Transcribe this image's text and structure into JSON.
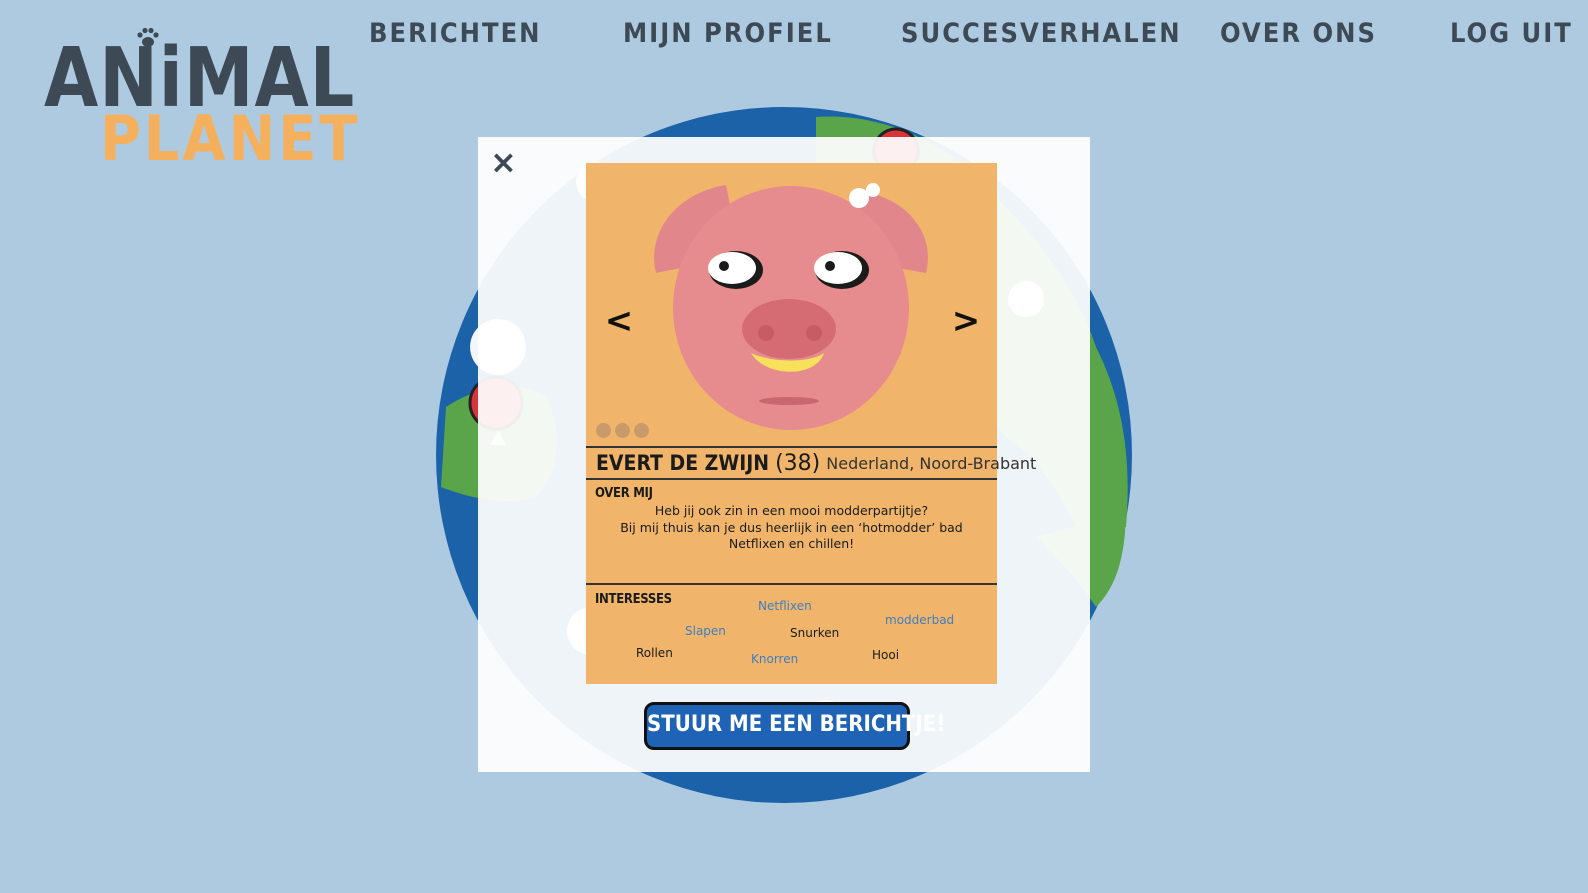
{
  "brand": {
    "line1": "ANiMAL",
    "line2": "PLANET",
    "paw_icon": "paw-icon"
  },
  "nav": {
    "items": [
      {
        "label": "BERICHTEN"
      },
      {
        "label": "MIJN PROFIEL"
      },
      {
        "label": "SUCCESVERHALEN"
      },
      {
        "label": "OVER ONS"
      },
      {
        "label": "LOG UIT"
      }
    ]
  },
  "modal": {
    "close_icon": "×",
    "carousel": {
      "prev": "<",
      "next": ">",
      "photo_count": 3
    },
    "profile": {
      "name": "EVERT DE ZWIJN",
      "age": "(38)",
      "location": "Nederland, Noord-Brabant"
    },
    "about": {
      "title": "OVER MIJ",
      "lines": [
        "Heb jij ook zin in een mooi modderpartijtje?",
        "Bij mij thuis kan je dus heerlijk in een ‘hotmodder’ bad",
        "Netflixen en chillen!"
      ]
    },
    "interests": {
      "title": "INTERESSES",
      "tags": [
        "Netflixen",
        "modderbad",
        "Slapen",
        "Snurken",
        "Rollen",
        "Knorren",
        "Hooi"
      ]
    },
    "send_button": "STUUR ME EEN BERICHTJE!"
  },
  "colors": {
    "background": "#aecae0",
    "brand_dark": "#3d4a55",
    "brand_orange": "#f5b05e",
    "card": "#f0b56b",
    "button": "#1e63b5",
    "tag_blue": "#3d7fc2"
  }
}
